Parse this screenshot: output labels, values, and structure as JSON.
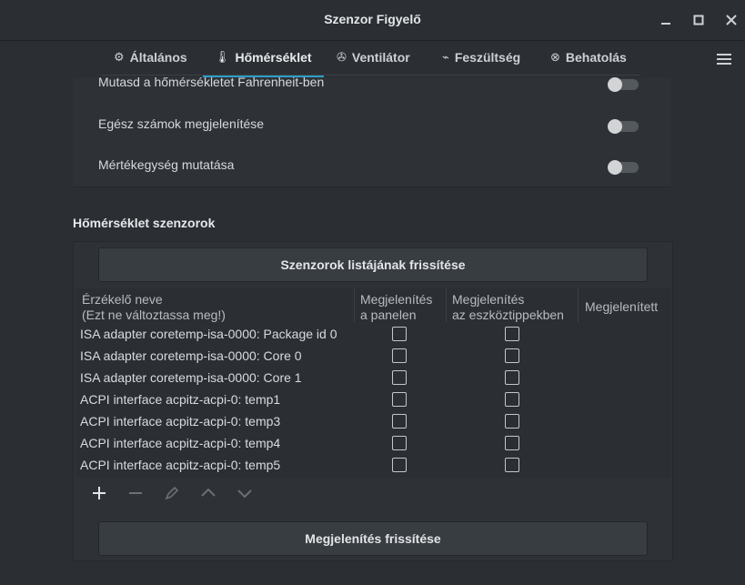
{
  "window": {
    "title": "Szenzor Figyelő"
  },
  "tabs": [
    {
      "label": "Általános",
      "icon": "gear-icon"
    },
    {
      "label": "Hőmérséklet",
      "icon": "thermometer-icon"
    },
    {
      "label": "Ventilátor",
      "icon": "fan-icon"
    },
    {
      "label": "Feszültség",
      "icon": "voltage-icon"
    },
    {
      "label": "Behatolás",
      "icon": "intrusion-icon"
    }
  ],
  "toggles": [
    {
      "label": "Mutasd a hőmérsékletet Fahrenheit-ben",
      "on": false
    },
    {
      "label": "Egész számok megjelenítése",
      "on": false
    },
    {
      "label": "Mértékegység mutatása",
      "on": false
    }
  ],
  "sensors_section": {
    "title": "Hőmérséklet szenzorok",
    "refresh_list_button": "Szenzorok listájának frissítése",
    "columns": {
      "name_line1": "Érzékelő neve",
      "name_line2": "(Ezt ne változtassa meg!)",
      "panel_line1": "Megjelenítés",
      "panel_line2": "a panelen",
      "tooltip_line1": "Megjelenítés",
      "tooltip_line2": "az eszköztippekben",
      "displayed": "Megjelenített"
    },
    "rows": [
      {
        "name": "ISA adapter coretemp-isa-0000: Package id 0",
        "panel": false,
        "tooltip": false
      },
      {
        "name": "ISA adapter coretemp-isa-0000: Core 0",
        "panel": false,
        "tooltip": false
      },
      {
        "name": "ISA adapter coretemp-isa-0000: Core 1",
        "panel": false,
        "tooltip": false
      },
      {
        "name": "ACPI interface acpitz-acpi-0: temp1",
        "panel": false,
        "tooltip": false
      },
      {
        "name": "ACPI interface acpitz-acpi-0: temp3",
        "panel": false,
        "tooltip": false
      },
      {
        "name": "ACPI interface acpitz-acpi-0: temp4",
        "panel": false,
        "tooltip": false
      },
      {
        "name": "ACPI interface acpitz-acpi-0: temp5",
        "panel": false,
        "tooltip": false
      }
    ],
    "toolbar_icons": [
      "add-icon",
      "remove-icon",
      "edit-icon",
      "move-up-icon",
      "move-down-icon"
    ],
    "refresh_display_button": "Megjelenítés frissítése"
  },
  "colors": {
    "accent": "#2f9ec5",
    "background": "#2b2f33"
  }
}
